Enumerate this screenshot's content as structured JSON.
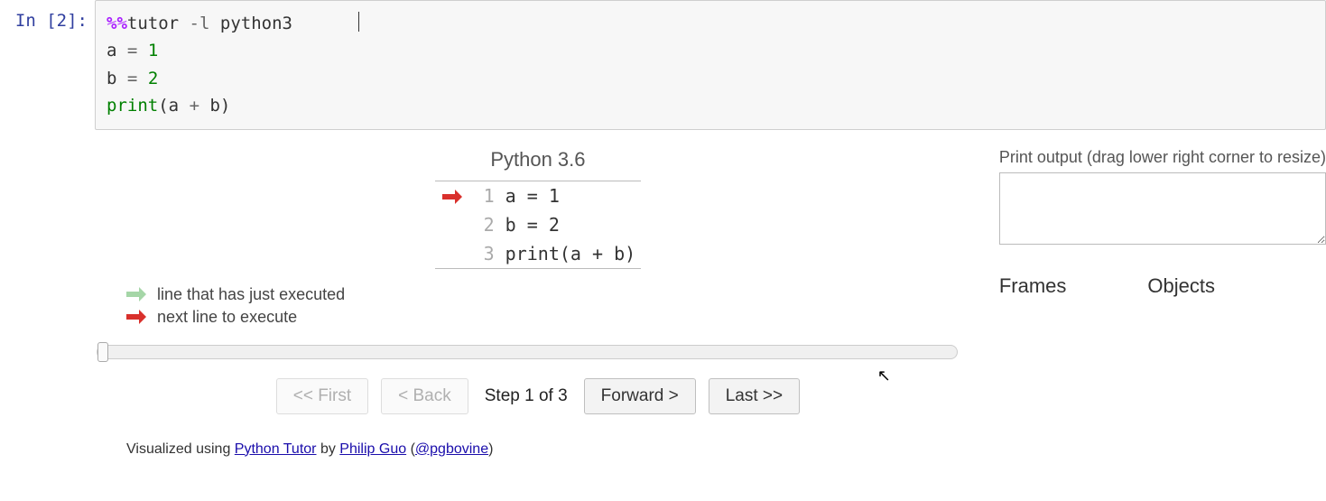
{
  "cell": {
    "prompt": "In [2]:",
    "code": {
      "magic_prefix": "%%",
      "magic_name": "tutor",
      "flag": "-l",
      "flag_arg": "python3",
      "line2_lhs": "a",
      "line2_op": "=",
      "line2_rhs": "1",
      "line3_lhs": "b",
      "line3_op": "=",
      "line3_rhs": "2",
      "line4_func": "print",
      "line4_open": "(",
      "line4_a": "a",
      "line4_plus": "+",
      "line4_b": "b",
      "line4_close": ")"
    }
  },
  "viz": {
    "lang_title": "Python 3.6",
    "lines": [
      {
        "n": "1",
        "code": "a = 1",
        "arrow": "red"
      },
      {
        "n": "2",
        "code": "b = 2",
        "arrow": ""
      },
      {
        "n": "3",
        "code": "print(a + b)",
        "arrow": ""
      }
    ],
    "legend_executed": "line that has just executed",
    "legend_next": "next line to execute",
    "step_label": "Step 1 of 3",
    "btn_first": "<< First",
    "btn_back": "< Back",
    "btn_forward": "Forward >",
    "btn_last": "Last >>",
    "slider": {
      "min": "1",
      "max": "3",
      "value": "1"
    }
  },
  "right": {
    "print_label": "Print output (drag lower right corner to resize)",
    "print_value": "",
    "frames_label": "Frames",
    "objects_label": "Objects"
  },
  "credit": {
    "prefix": "Visualized using ",
    "tutor": "Python Tutor",
    "by": " by ",
    "author": "Philip Guo",
    "open": " (",
    "handle": "@pgbovine",
    "close": ")"
  }
}
